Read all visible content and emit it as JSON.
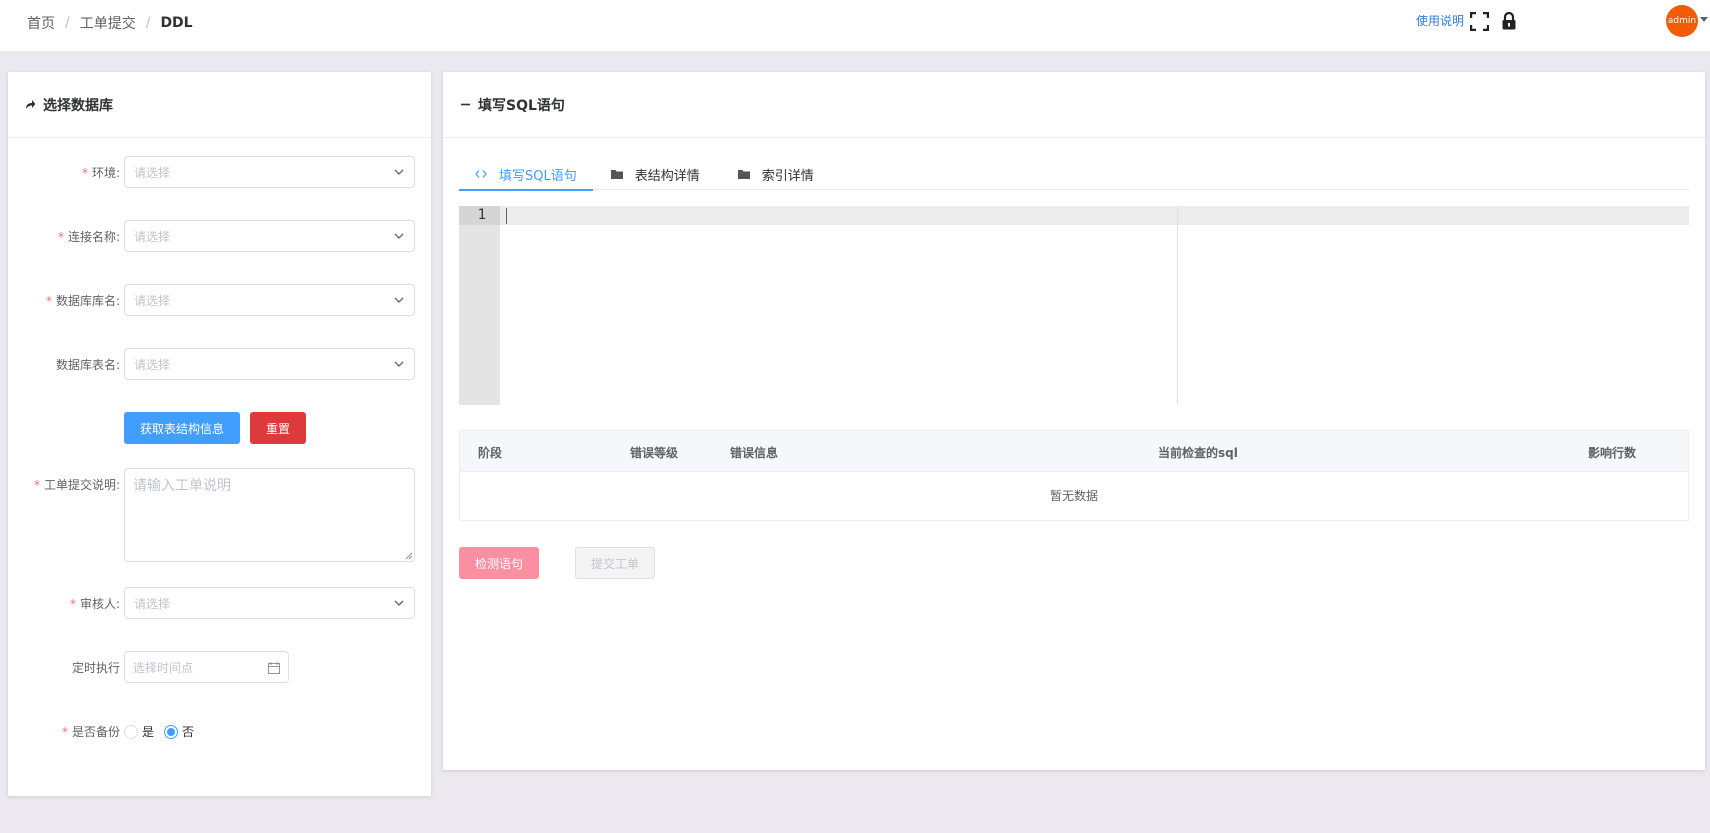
{
  "breadcrumb": {
    "items": [
      "首页",
      "工单提交",
      "DDL"
    ],
    "separator": "/"
  },
  "header": {
    "help_label": "使用说明",
    "fullscreen_icon": "fullscreen-icon",
    "lock_icon": "lock-icon",
    "avatar_text": "admin"
  },
  "left_panel": {
    "title": "选择数据库",
    "icon": "share-arrow-icon",
    "fields": {
      "env": {
        "label": "环境:",
        "placeholder": "请选择",
        "required": true
      },
      "connection": {
        "label": "连接名称:",
        "placeholder": "请选择",
        "required": true
      },
      "database": {
        "label": "数据库库名:",
        "placeholder": "请选择",
        "required": true
      },
      "table": {
        "label": "数据库表名:",
        "placeholder": "请选择",
        "required": false
      },
      "description": {
        "label": "工单提交说明:",
        "placeholder": "请输入工单说明",
        "required": true
      },
      "reviewer": {
        "label": "审核人:",
        "placeholder": "请选择",
        "required": true
      },
      "schedule": {
        "label": "定时执行",
        "placeholder": "选择时间点",
        "required": false
      },
      "backup": {
        "label": "是否备份",
        "required": true,
        "options": [
          "是",
          "否"
        ],
        "selected": "否"
      }
    },
    "buttons": {
      "fetch": "获取表结构信息",
      "reset": "重置"
    },
    "required_mark": "*"
  },
  "right_panel": {
    "title": "填写SQL语句",
    "icon": "minus-icon",
    "tabs": [
      {
        "label": "填写SQL语句",
        "icon": "code-icon",
        "active": true
      },
      {
        "label": "表结构详情",
        "icon": "folder-icon",
        "active": false
      },
      {
        "label": "索引详情",
        "icon": "folder-icon",
        "active": false
      }
    ],
    "editor": {
      "line_number": "1"
    },
    "table": {
      "columns": [
        "阶段",
        "错误等级",
        "错误信息",
        "当前检查的sql",
        "影响行数"
      ],
      "empty_text": "暂无数据"
    },
    "buttons": {
      "check": "检测语句",
      "submit": "提交工单"
    }
  },
  "colors": {
    "primary": "#409eff",
    "danger": "#dd3b3b",
    "accent_orange": "#f35b06",
    "check_button": "#fa8fa1"
  }
}
